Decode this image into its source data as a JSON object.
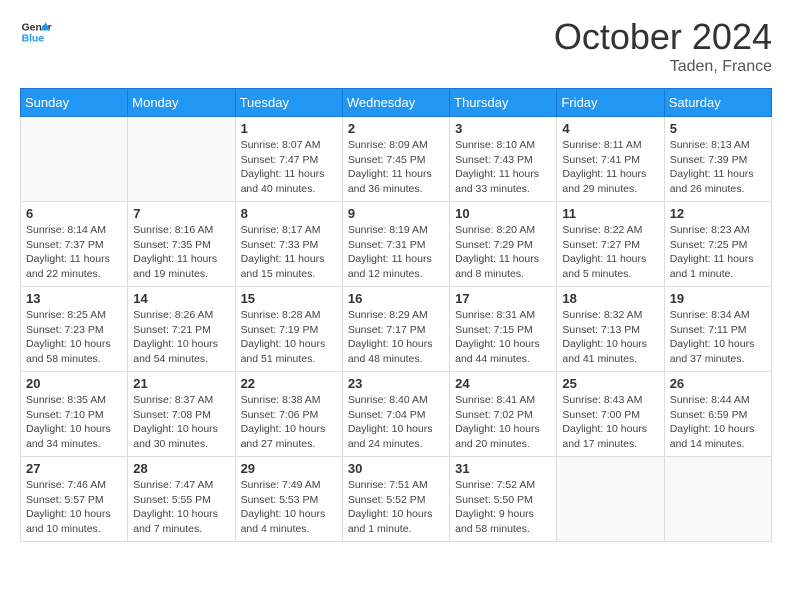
{
  "header": {
    "logo": {
      "line1": "General",
      "line2": "Blue"
    },
    "title": "October 2024",
    "subtitle": "Taden, France"
  },
  "days_of_week": [
    "Sunday",
    "Monday",
    "Tuesday",
    "Wednesday",
    "Thursday",
    "Friday",
    "Saturday"
  ],
  "weeks": [
    [
      {
        "day": "",
        "sunrise": "",
        "sunset": "",
        "daylight": ""
      },
      {
        "day": "",
        "sunrise": "",
        "sunset": "",
        "daylight": ""
      },
      {
        "day": "1",
        "sunrise": "Sunrise: 8:07 AM",
        "sunset": "Sunset: 7:47 PM",
        "daylight": "Daylight: 11 hours and 40 minutes."
      },
      {
        "day": "2",
        "sunrise": "Sunrise: 8:09 AM",
        "sunset": "Sunset: 7:45 PM",
        "daylight": "Daylight: 11 hours and 36 minutes."
      },
      {
        "day": "3",
        "sunrise": "Sunrise: 8:10 AM",
        "sunset": "Sunset: 7:43 PM",
        "daylight": "Daylight: 11 hours and 33 minutes."
      },
      {
        "day": "4",
        "sunrise": "Sunrise: 8:11 AM",
        "sunset": "Sunset: 7:41 PM",
        "daylight": "Daylight: 11 hours and 29 minutes."
      },
      {
        "day": "5",
        "sunrise": "Sunrise: 8:13 AM",
        "sunset": "Sunset: 7:39 PM",
        "daylight": "Daylight: 11 hours and 26 minutes."
      }
    ],
    [
      {
        "day": "6",
        "sunrise": "Sunrise: 8:14 AM",
        "sunset": "Sunset: 7:37 PM",
        "daylight": "Daylight: 11 hours and 22 minutes."
      },
      {
        "day": "7",
        "sunrise": "Sunrise: 8:16 AM",
        "sunset": "Sunset: 7:35 PM",
        "daylight": "Daylight: 11 hours and 19 minutes."
      },
      {
        "day": "8",
        "sunrise": "Sunrise: 8:17 AM",
        "sunset": "Sunset: 7:33 PM",
        "daylight": "Daylight: 11 hours and 15 minutes."
      },
      {
        "day": "9",
        "sunrise": "Sunrise: 8:19 AM",
        "sunset": "Sunset: 7:31 PM",
        "daylight": "Daylight: 11 hours and 12 minutes."
      },
      {
        "day": "10",
        "sunrise": "Sunrise: 8:20 AM",
        "sunset": "Sunset: 7:29 PM",
        "daylight": "Daylight: 11 hours and 8 minutes."
      },
      {
        "day": "11",
        "sunrise": "Sunrise: 8:22 AM",
        "sunset": "Sunset: 7:27 PM",
        "daylight": "Daylight: 11 hours and 5 minutes."
      },
      {
        "day": "12",
        "sunrise": "Sunrise: 8:23 AM",
        "sunset": "Sunset: 7:25 PM",
        "daylight": "Daylight: 11 hours and 1 minute."
      }
    ],
    [
      {
        "day": "13",
        "sunrise": "Sunrise: 8:25 AM",
        "sunset": "Sunset: 7:23 PM",
        "daylight": "Daylight: 10 hours and 58 minutes."
      },
      {
        "day": "14",
        "sunrise": "Sunrise: 8:26 AM",
        "sunset": "Sunset: 7:21 PM",
        "daylight": "Daylight: 10 hours and 54 minutes."
      },
      {
        "day": "15",
        "sunrise": "Sunrise: 8:28 AM",
        "sunset": "Sunset: 7:19 PM",
        "daylight": "Daylight: 10 hours and 51 minutes."
      },
      {
        "day": "16",
        "sunrise": "Sunrise: 8:29 AM",
        "sunset": "Sunset: 7:17 PM",
        "daylight": "Daylight: 10 hours and 48 minutes."
      },
      {
        "day": "17",
        "sunrise": "Sunrise: 8:31 AM",
        "sunset": "Sunset: 7:15 PM",
        "daylight": "Daylight: 10 hours and 44 minutes."
      },
      {
        "day": "18",
        "sunrise": "Sunrise: 8:32 AM",
        "sunset": "Sunset: 7:13 PM",
        "daylight": "Daylight: 10 hours and 41 minutes."
      },
      {
        "day": "19",
        "sunrise": "Sunrise: 8:34 AM",
        "sunset": "Sunset: 7:11 PM",
        "daylight": "Daylight: 10 hours and 37 minutes."
      }
    ],
    [
      {
        "day": "20",
        "sunrise": "Sunrise: 8:35 AM",
        "sunset": "Sunset: 7:10 PM",
        "daylight": "Daylight: 10 hours and 34 minutes."
      },
      {
        "day": "21",
        "sunrise": "Sunrise: 8:37 AM",
        "sunset": "Sunset: 7:08 PM",
        "daylight": "Daylight: 10 hours and 30 minutes."
      },
      {
        "day": "22",
        "sunrise": "Sunrise: 8:38 AM",
        "sunset": "Sunset: 7:06 PM",
        "daylight": "Daylight: 10 hours and 27 minutes."
      },
      {
        "day": "23",
        "sunrise": "Sunrise: 8:40 AM",
        "sunset": "Sunset: 7:04 PM",
        "daylight": "Daylight: 10 hours and 24 minutes."
      },
      {
        "day": "24",
        "sunrise": "Sunrise: 8:41 AM",
        "sunset": "Sunset: 7:02 PM",
        "daylight": "Daylight: 10 hours and 20 minutes."
      },
      {
        "day": "25",
        "sunrise": "Sunrise: 8:43 AM",
        "sunset": "Sunset: 7:00 PM",
        "daylight": "Daylight: 10 hours and 17 minutes."
      },
      {
        "day": "26",
        "sunrise": "Sunrise: 8:44 AM",
        "sunset": "Sunset: 6:59 PM",
        "daylight": "Daylight: 10 hours and 14 minutes."
      }
    ],
    [
      {
        "day": "27",
        "sunrise": "Sunrise: 7:46 AM",
        "sunset": "Sunset: 5:57 PM",
        "daylight": "Daylight: 10 hours and 10 minutes."
      },
      {
        "day": "28",
        "sunrise": "Sunrise: 7:47 AM",
        "sunset": "Sunset: 5:55 PM",
        "daylight": "Daylight: 10 hours and 7 minutes."
      },
      {
        "day": "29",
        "sunrise": "Sunrise: 7:49 AM",
        "sunset": "Sunset: 5:53 PM",
        "daylight": "Daylight: 10 hours and 4 minutes."
      },
      {
        "day": "30",
        "sunrise": "Sunrise: 7:51 AM",
        "sunset": "Sunset: 5:52 PM",
        "daylight": "Daylight: 10 hours and 1 minute."
      },
      {
        "day": "31",
        "sunrise": "Sunrise: 7:52 AM",
        "sunset": "Sunset: 5:50 PM",
        "daylight": "Daylight: 9 hours and 58 minutes."
      },
      {
        "day": "",
        "sunrise": "",
        "sunset": "",
        "daylight": ""
      },
      {
        "day": "",
        "sunrise": "",
        "sunset": "",
        "daylight": ""
      }
    ]
  ]
}
